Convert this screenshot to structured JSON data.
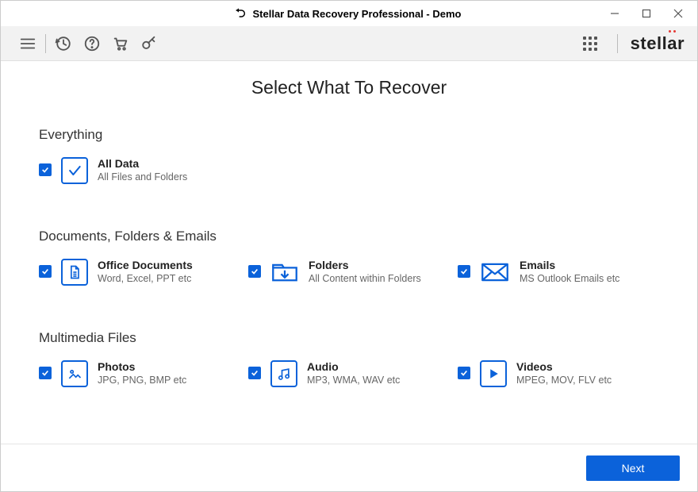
{
  "window": {
    "title": "Stellar Data Recovery Professional - Demo"
  },
  "brand": "stellar",
  "page": {
    "title": "Select What To Recover"
  },
  "sections": {
    "everything": {
      "label": "Everything",
      "items": {
        "all": {
          "title": "All Data",
          "sub": "All Files and Folders"
        }
      }
    },
    "docs": {
      "label": "Documents, Folders & Emails",
      "items": {
        "office": {
          "title": "Office Documents",
          "sub": "Word, Excel, PPT etc"
        },
        "folders": {
          "title": "Folders",
          "sub": "All Content within Folders"
        },
        "emails": {
          "title": "Emails",
          "sub": "MS Outlook Emails etc"
        }
      }
    },
    "media": {
      "label": "Multimedia Files",
      "items": {
        "photos": {
          "title": "Photos",
          "sub": "JPG, PNG, BMP etc"
        },
        "audio": {
          "title": "Audio",
          "sub": "MP3, WMA, WAV etc"
        },
        "videos": {
          "title": "Videos",
          "sub": "MPEG, MOV, FLV etc"
        }
      }
    }
  },
  "footer": {
    "next": "Next"
  },
  "colors": {
    "primary": "#0b62da",
    "accent": "#e53935"
  }
}
